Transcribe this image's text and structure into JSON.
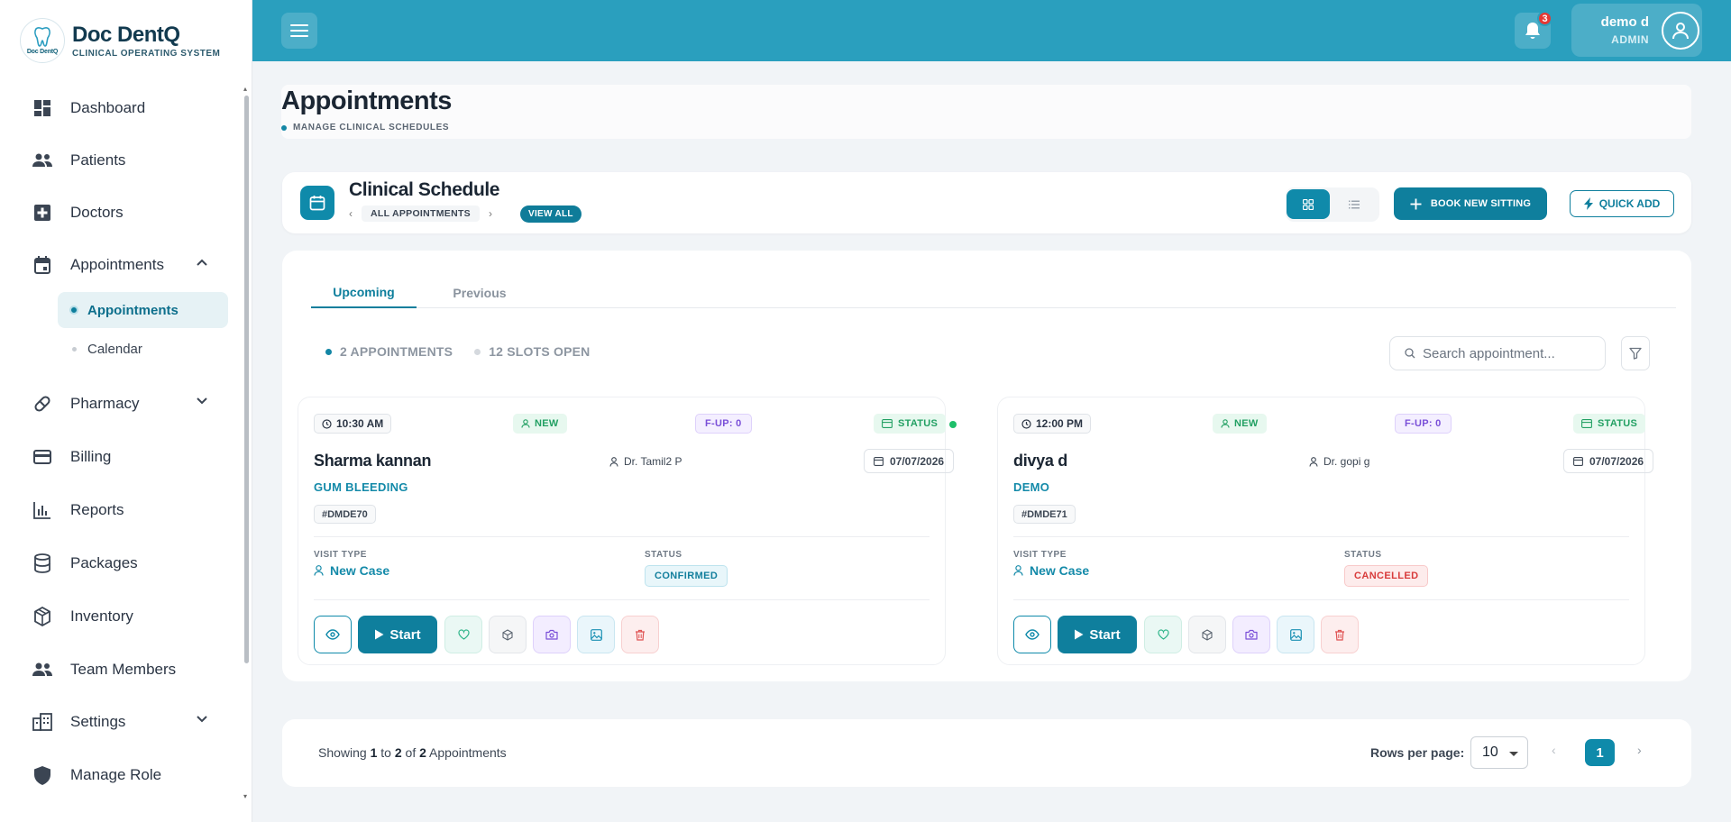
{
  "brand": {
    "title": "Doc DentQ",
    "subtitle": "CLINICAL OPERATING SYSTEM",
    "logo_text": "Doc DentQ"
  },
  "sidebar": {
    "items": [
      {
        "label": "Dashboard",
        "icon": "dashboard-icon"
      },
      {
        "label": "Patients",
        "icon": "people-icon"
      },
      {
        "label": "Doctors",
        "icon": "medical-plus-icon"
      },
      {
        "label": "Appointments",
        "icon": "calendar-icon",
        "expanded": true
      },
      {
        "label": "Pharmacy",
        "icon": "pill-icon"
      },
      {
        "label": "Billing",
        "icon": "credit-card-icon"
      },
      {
        "label": "Reports",
        "icon": "bar-chart-icon"
      },
      {
        "label": "Packages",
        "icon": "database-icon"
      },
      {
        "label": "Inventory",
        "icon": "box-icon"
      },
      {
        "label": "Team Members",
        "icon": "team-icon"
      },
      {
        "label": "Settings",
        "icon": "building-icon"
      },
      {
        "label": "Manage Role",
        "icon": "shield-icon"
      }
    ],
    "sub_items": [
      {
        "label": "Appointments",
        "active": true
      },
      {
        "label": "Calendar",
        "active": false
      }
    ]
  },
  "topbar": {
    "notification_count": "3",
    "user_name": "demo d",
    "user_role": "ADMIN"
  },
  "page": {
    "title": "Appointments",
    "subtitle": "MANAGE CLINICAL SCHEDULES"
  },
  "schedule": {
    "title": "Clinical Schedule",
    "breadcrumb": "ALL APPOINTMENTS",
    "view_all": "VIEW ALL",
    "book_label": "BOOK NEW SITTING",
    "quick_label": "QUICK ADD"
  },
  "tabs": [
    {
      "label": "Upcoming",
      "active": true
    },
    {
      "label": "Previous",
      "active": false
    }
  ],
  "stats": {
    "appointments": "2 APPOINTMENTS",
    "slots": "12 SLOTS OPEN"
  },
  "search": {
    "placeholder": "Search appointment..."
  },
  "cards": [
    {
      "time": "10:30 AM",
      "new_label": "NEW",
      "fup": "F-UP: 0",
      "status_label": "STATUS",
      "name": "Sharma kannan",
      "doctor": "Dr. Tamil2 P",
      "date": "07/07/2026",
      "reason": "GUM BLEEDING",
      "id": "#DMDE70",
      "visit_type_label": "VISIT TYPE",
      "visit_type": "New Case",
      "status_title": "STATUS",
      "status": "CONFIRMED",
      "status_kind": "confirmed",
      "start_label": "Start",
      "live": true
    },
    {
      "time": "12:00 PM",
      "new_label": "NEW",
      "fup": "F-UP: 0",
      "status_label": "STATUS",
      "name": "divya d",
      "doctor": "Dr. gopi g",
      "date": "07/07/2026",
      "reason": "DEMO",
      "id": "#DMDE71",
      "visit_type_label": "VISIT TYPE",
      "visit_type": "New Case",
      "status_title": "STATUS",
      "status": "CANCELLED",
      "status_kind": "cancelled",
      "start_label": "Start",
      "live": false
    }
  ],
  "footer": {
    "showing_prefix": "Showing",
    "from": "1",
    "to_word": "to",
    "to": "2",
    "of_word": "of",
    "total": "2",
    "suffix": "Appointments",
    "rows_label": "Rows per page:",
    "rows_value": "10",
    "current_page": "1"
  },
  "colors": {
    "primary": "#0f7f9d",
    "topbar": "#2a9fbe",
    "success": "#22a063",
    "danger": "#d83b3b",
    "violet": "#7a4fd8"
  }
}
